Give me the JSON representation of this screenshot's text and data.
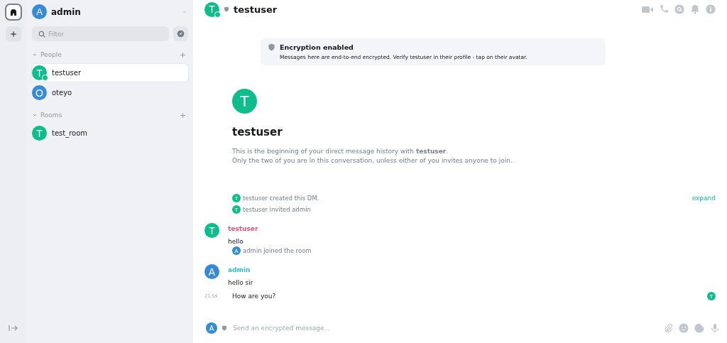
{
  "user": {
    "letter": "A",
    "name": "admin",
    "color": "#368bd6"
  },
  "filter": {
    "placeholder": "Filter"
  },
  "sections": [
    {
      "title": "People",
      "expanded": true,
      "items": [
        {
          "letter": "T",
          "name": "testuser",
          "color": "#0dbd8b",
          "selected": true,
          "online": true
        },
        {
          "letter": "O",
          "name": "oteyo",
          "color": "#368bd6",
          "selected": false,
          "online": false
        }
      ]
    },
    {
      "title": "Rooms",
      "expanded": true,
      "items": [
        {
          "letter": "T",
          "name": "test_room",
          "color": "#0dbd8b",
          "selected": false,
          "online": false
        }
      ]
    }
  ],
  "header": {
    "letter": "T",
    "name": "testuser",
    "color": "#0dbd8b",
    "online": true
  },
  "encryption": {
    "title": "Encryption enabled",
    "text": "Messages here are end-to-end encrypted. Verify testuser in their profile - tap on their avatar."
  },
  "intro": {
    "letter": "T",
    "name": "testuser",
    "color": "#0dbd8b",
    "text": "This is the beginning of your direct message history with **testuser**.",
    "text2": "Only the two of you are in this conversation, unless either of you invites anyone to join."
  },
  "timeline": [
    {
      "kind": "event",
      "letter": "T",
      "color": "#0dbd8b",
      "text": "testuser created this DM.",
      "action": "expand"
    },
    {
      "kind": "event",
      "letter": "T",
      "color": "#0dbd8b",
      "text": "testuser invited admin"
    },
    {
      "kind": "message",
      "letter": "T",
      "color": "#0dbd8b",
      "sender": {
        "name": "testuser",
        "color": "#e64f7a"
      },
      "body": "hello"
    },
    {
      "kind": "event",
      "letter": "A",
      "color": "#368bd6",
      "text": "admin joined the room"
    },
    {
      "kind": "message",
      "letter": "A",
      "color": "#368bd6",
      "sender": {
        "name": "admin",
        "color": "#2dc2c5"
      },
      "body": "hello sir"
    },
    {
      "kind": "continuation",
      "time": "21:59",
      "body": "How are you?",
      "receipt": {
        "letter": "T",
        "color": "#0dbd8b"
      }
    }
  ],
  "composer": {
    "letter": "A",
    "color": "#368bd6",
    "placeholder": "Send an encrypted message..."
  }
}
